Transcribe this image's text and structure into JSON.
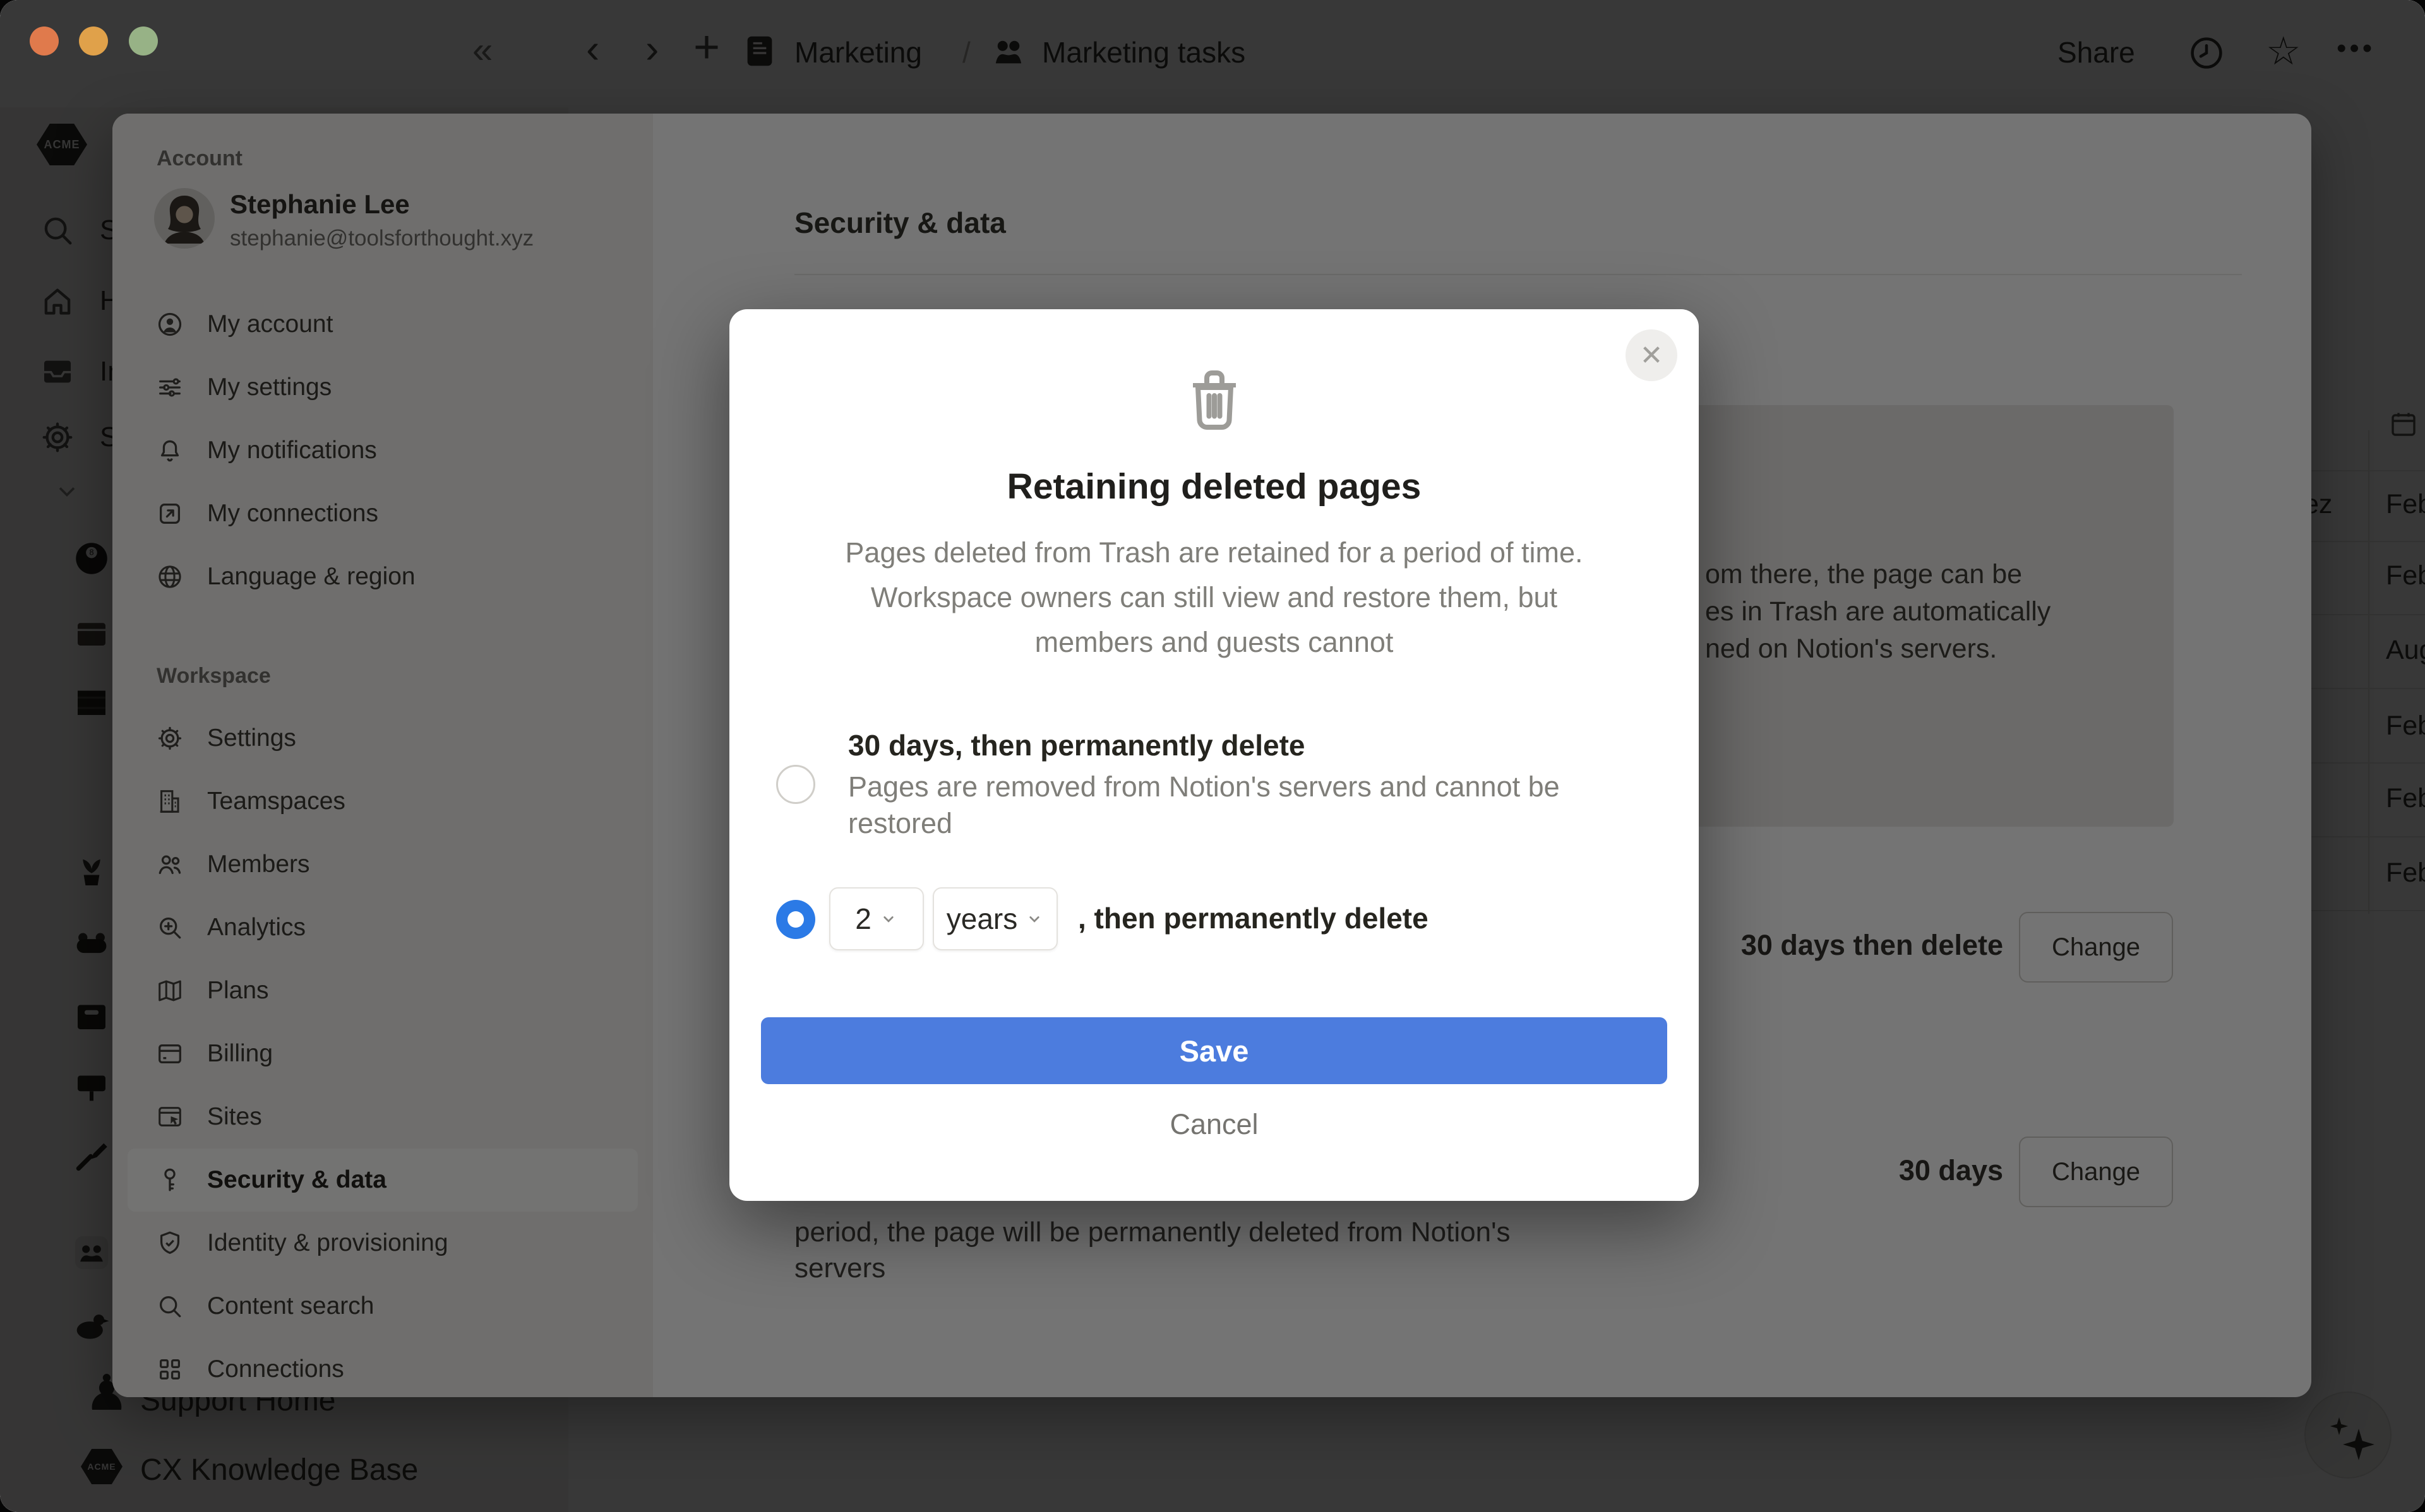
{
  "topbar": {
    "collapse_glyph": "«",
    "back_glyph": "‹",
    "forward_glyph": "›",
    "plus_glyph": "+",
    "breadcrumb_page": "Marketing",
    "breadcrumb_sep": "/",
    "breadcrumb_current": "Marketing tasks",
    "share_label": "Share",
    "star_glyph": "☆",
    "ellipsis_glyph": "•••"
  },
  "app_sidebar": {
    "workspace_logo": "ACME",
    "workspace_logo_mini": "ACME",
    "nav": [
      {
        "label": "Search"
      },
      {
        "label": "Home"
      },
      {
        "label": "Inbox"
      },
      {
        "label": "Settings"
      }
    ],
    "pawn_glyph": "♟",
    "bottom_items": [
      {
        "label": "Support Home"
      },
      {
        "label": "CX Knowledge Base"
      }
    ]
  },
  "settings": {
    "account_section_label": "Account",
    "profile": {
      "name": "Stephanie Lee",
      "email": "stephanie@toolsforthought.xyz"
    },
    "account_items": [
      {
        "label": "My account"
      },
      {
        "label": "My settings"
      },
      {
        "label": "My notifications"
      },
      {
        "label": "My connections"
      },
      {
        "label": "Language & region"
      }
    ],
    "workspace_section_label": "Workspace",
    "workspace_items": [
      {
        "label": "Settings"
      },
      {
        "label": "Teamspaces"
      },
      {
        "label": "Members"
      },
      {
        "label": "Analytics"
      },
      {
        "label": "Plans"
      },
      {
        "label": "Billing"
      },
      {
        "label": "Sites"
      },
      {
        "label": "Security & data",
        "selected": true
      },
      {
        "label": "Identity & provisioning"
      },
      {
        "label": "Content search"
      },
      {
        "label": "Connections"
      }
    ],
    "content": {
      "heading": "Security & data",
      "callout_fragments": [
        "om there, the page can be",
        "es in Trash are automatically",
        "ned on Notion's servers."
      ],
      "rows": [
        {
          "value": "30 days then delete",
          "action": "Change"
        },
        {
          "value": "30 days",
          "action": "Change"
        }
      ],
      "paragraph_lines": [
        "period, the page will be permanently deleted from Notion's",
        "servers"
      ]
    }
  },
  "modal": {
    "close_glyph": "✕",
    "title": "Retaining deleted pages",
    "description_lines": [
      "Pages deleted from Trash are retained for a period of time.",
      "Workspace owners can still view and restore them, but",
      "members and guests cannot"
    ],
    "options": [
      {
        "label": "30 days, then permanently delete",
        "sub_lines": [
          "Pages are removed from Notion's servers and cannot be",
          "restored"
        ],
        "selected": false
      },
      {
        "number_value": "2",
        "unit_value": "years",
        "suffix": ", then permanently delete",
        "selected": true
      }
    ],
    "save_label": "Save",
    "cancel_label": "Cancel"
  },
  "table_strip": {
    "partial_left_cell": "ez",
    "rows": [
      "Feb",
      "Feb",
      "Aug",
      "Feb",
      "Feb",
      "Feb"
    ]
  },
  "colors": {
    "accent_blue": "#4C7CDE",
    "radio_blue": "#2B7AE6",
    "traffic_lights": [
      "#E07A4C",
      "#E0A14A",
      "#97B286"
    ]
  }
}
